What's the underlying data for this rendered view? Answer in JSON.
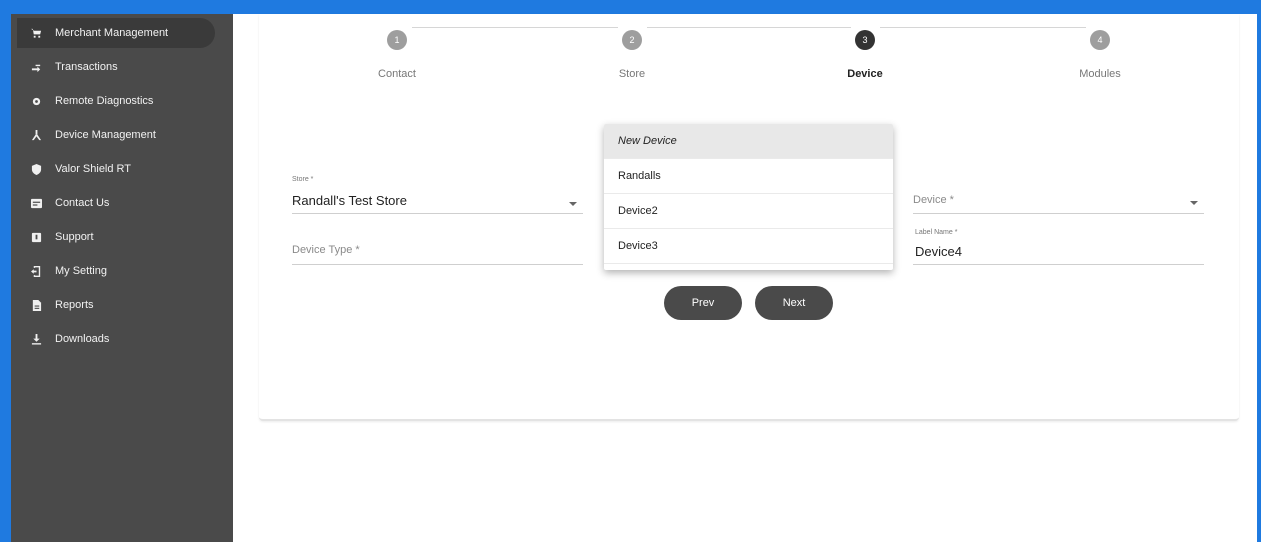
{
  "sidebar": {
    "items": [
      {
        "label": "Merchant Management",
        "icon": "cart-icon"
      },
      {
        "label": "Transactions",
        "icon": "transfer-icon"
      },
      {
        "label": "Remote Diagnostics",
        "icon": "gear-icon"
      },
      {
        "label": "Device Management",
        "icon": "network-icon"
      },
      {
        "label": "Valor Shield RT",
        "icon": "shield-icon"
      },
      {
        "label": "Contact Us",
        "icon": "contact-card-icon"
      },
      {
        "label": "Support",
        "icon": "support-icon"
      },
      {
        "label": "My Setting",
        "icon": "settings-door-icon"
      },
      {
        "label": "Reports",
        "icon": "report-icon"
      },
      {
        "label": "Downloads",
        "icon": "download-icon"
      }
    ]
  },
  "stepper": {
    "steps": [
      {
        "number": "1",
        "label": "Contact"
      },
      {
        "number": "2",
        "label": "Store"
      },
      {
        "number": "3",
        "label": "Device"
      },
      {
        "number": "4",
        "label": "Modules"
      }
    ],
    "active_step": "Device"
  },
  "form": {
    "store": {
      "label": "Store *",
      "value": "Randall's Test Store"
    },
    "device_type": {
      "placeholder": "Device Type *"
    },
    "device": {
      "placeholder": "Device *"
    },
    "label_name": {
      "label": "Label Name *",
      "value": "Device4"
    }
  },
  "dropdown": {
    "options": [
      "New Device",
      "Randalls",
      "Device2",
      "Device3"
    ]
  },
  "buttons": {
    "prev": "Prev",
    "next": "Next"
  },
  "colors": {
    "frame": "#1f7ae0",
    "sidebar_bg": "#4a4a4a",
    "button_bg": "#4a4a4a"
  }
}
